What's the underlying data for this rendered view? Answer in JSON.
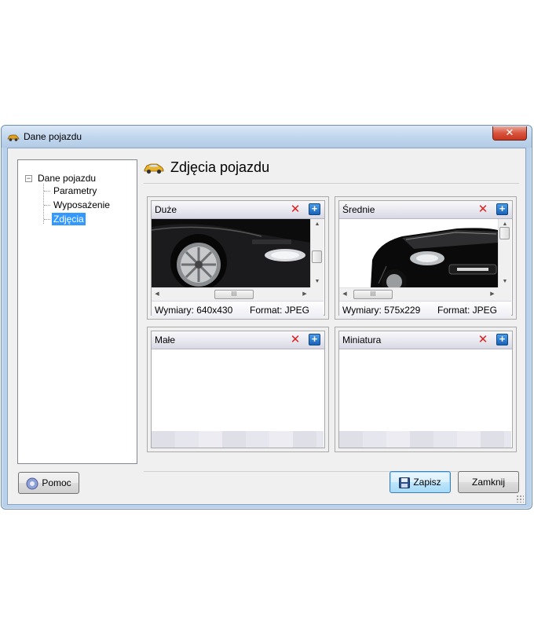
{
  "window": {
    "title": "Dane pojazdu",
    "close_glyph": "✕"
  },
  "tree": {
    "expander_glyph": "−",
    "root": "Dane pojazdu",
    "items": [
      "Parametry",
      "Wyposażenie",
      "Zdjęcia"
    ],
    "selected": "Zdjęcia"
  },
  "header": {
    "title": "Zdjęcia pojazdu"
  },
  "panels": {
    "large": {
      "label": "Duże",
      "dimensions": "Wymiary: 640x430",
      "format": "Format: JPEG"
    },
    "medium": {
      "label": "Średnie",
      "dimensions": "Wymiary: 575x229",
      "format": "Format: JPEG"
    },
    "small": {
      "label": "Małe"
    },
    "thumb": {
      "label": "Miniatura"
    }
  },
  "panel_icons": {
    "delete": "✕",
    "add": "+"
  },
  "scroll": {
    "grip": "III"
  },
  "buttons": {
    "help": "Pomoc",
    "save": "Zapisz",
    "close": "Zamknij"
  },
  "colors": {
    "selection": "#3399ff",
    "delete": "#e02020",
    "add": "#1a62b6"
  }
}
